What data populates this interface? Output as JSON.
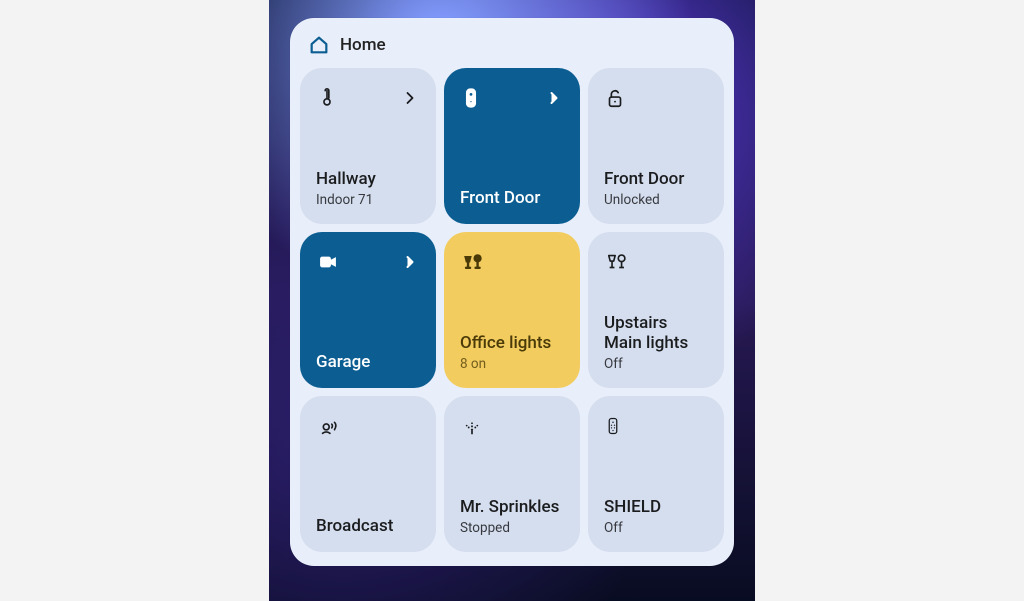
{
  "header": {
    "title": "Home"
  },
  "tiles": {
    "thermostat": {
      "title": "Hallway",
      "sub": "Indoor 71"
    },
    "doorbell": {
      "title": "Front Door"
    },
    "lock": {
      "title": "Front Door",
      "sub": "Unlocked"
    },
    "camera": {
      "title": "Garage"
    },
    "office": {
      "title": "Office lights",
      "sub": "8 on"
    },
    "upstairs": {
      "title": "Upstairs Main lights",
      "sub": "Off"
    },
    "broadcast": {
      "title": "Broadcast"
    },
    "sprinkler": {
      "title": "Mr. Sprinkles",
      "sub": "Stopped"
    },
    "shield": {
      "title": "SHIELD",
      "sub": "Off"
    }
  }
}
